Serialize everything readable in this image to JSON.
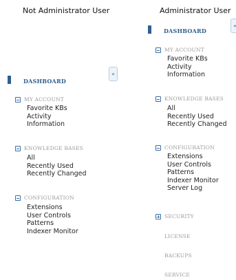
{
  "left": {
    "title": "Not Administrator User",
    "dashboard": "DASHBOARD",
    "collapse_icon": "«",
    "sections": [
      {
        "label": "MY ACCOUNT",
        "icon": "minus-box-icon",
        "items": [
          "Favorite KBs",
          "Activity",
          "Information"
        ]
      },
      {
        "label": "KNOWLEDGE BASES",
        "icon": "minus-box-icon",
        "items": [
          "All",
          "Recently Used",
          "Recently Changed"
        ]
      },
      {
        "label": "CONFIGURATION",
        "icon": "minus-box-icon",
        "items": [
          "Extensions",
          "User Controls",
          "Patterns",
          "Indexer Monitor"
        ]
      }
    ]
  },
  "right": {
    "title": "Administrator User",
    "dashboard": "DASHBOARD",
    "collapse_icon": "«",
    "sections": [
      {
        "label": "MY ACCOUNT",
        "icon": "minus-box-icon",
        "items": [
          "Favorite KBs",
          "Activity",
          "Information"
        ]
      },
      {
        "label": "KNOWLEDGE BASES",
        "icon": "minus-box-icon",
        "items": [
          "All",
          "Recently Used",
          "Recently Changed"
        ]
      },
      {
        "label": "CONFIGURATION",
        "icon": "minus-box-icon",
        "items": [
          "Extensions",
          "User Controls",
          "Patterns",
          "Indexer Monitor",
          "Server Log"
        ]
      },
      {
        "label": "SECURITY",
        "icon": "plus-box-icon",
        "items": []
      }
    ],
    "extra_links": [
      "LICENSE",
      "BACKUPS",
      "SERVICE"
    ]
  },
  "colors": {
    "accent": "#2e5f8e",
    "section_label": "#9a9a9a",
    "icon": "#3a6ea5"
  }
}
